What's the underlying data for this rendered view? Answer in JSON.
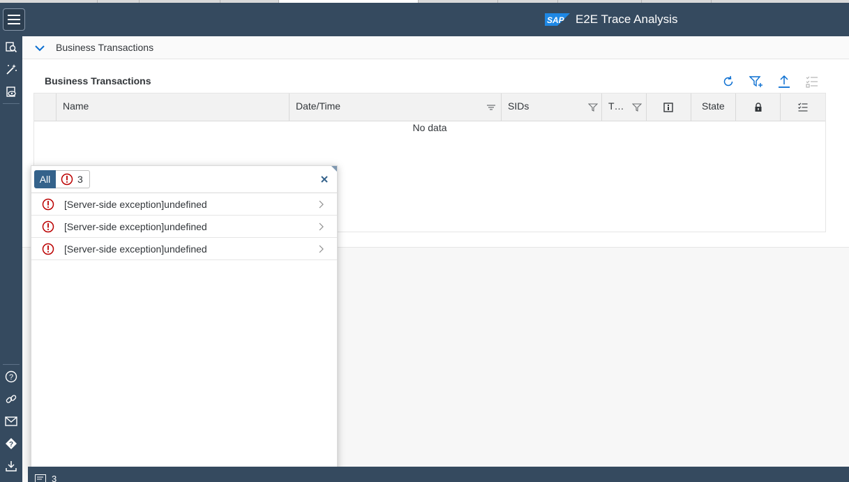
{
  "shell": {
    "app_title": "E2E Trace Analysis",
    "logo_text": "SAP",
    "colors": {
      "shell": "#354a5f",
      "accent": "#0a6ed1",
      "error": "#bb0000"
    }
  },
  "panel": {
    "title": "Business Transactions",
    "table_title": "Business Transactions",
    "toolbar": [
      "refresh-icon",
      "add-filter-icon",
      "upload-icon",
      "column-settings-icon"
    ]
  },
  "table": {
    "columns": [
      {
        "label": "Name"
      },
      {
        "label": "Date/Time"
      },
      {
        "label": "SIDs"
      },
      {
        "label": "T…"
      },
      {
        "label": ""
      },
      {
        "label": "State"
      },
      {
        "label": ""
      },
      {
        "label": ""
      }
    ],
    "empty_text": "No data"
  },
  "messages": {
    "filter_all": "All",
    "error_count": "3",
    "items": [
      {
        "text": "[Server-side exception]undefined"
      },
      {
        "text": "[Server-side exception]undefined"
      },
      {
        "text": "[Server-side exception]undefined"
      }
    ]
  },
  "footer": {
    "message_count": "3"
  }
}
